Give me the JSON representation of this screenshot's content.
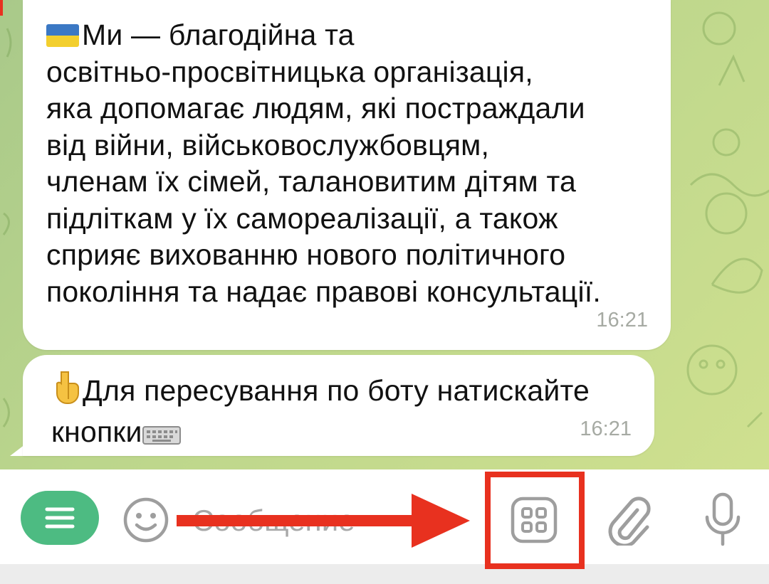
{
  "messages": [
    {
      "flag_emoji": "🇺🇦",
      "text": "Ми — благодійна та\nосвітньо-просвітницька організація,\nяка допомагає людям, які постраждали\nвід війни, військовослужбовцям,\nчленам їх сімей, талановитим дітям та\nпідліткам у їх самореалізації, а також\nсприяє вихованню нового політичного\nпокоління та надає правові консультації.",
      "time": "16:21"
    },
    {
      "lead_emoji": "👇",
      "text": "Для пересування по боту натискайте\nкнопки",
      "trail_emoji": "⌨️",
      "time": "16:21"
    }
  ],
  "input_bar": {
    "placeholder": "Сообщение",
    "menu_icon": "menu-icon",
    "emoji_icon": "smiley-icon",
    "keyboard_icon": "bot-keyboard-icon",
    "attach_icon": "paperclip-icon",
    "mic_icon": "microphone-icon"
  },
  "colors": {
    "menu_button": "#4dbb82",
    "annotation": "#e8311f",
    "chat_background": "#bcd68c",
    "timestamp": "#a6aaa3",
    "icon_gray": "#9e9e9e"
  }
}
